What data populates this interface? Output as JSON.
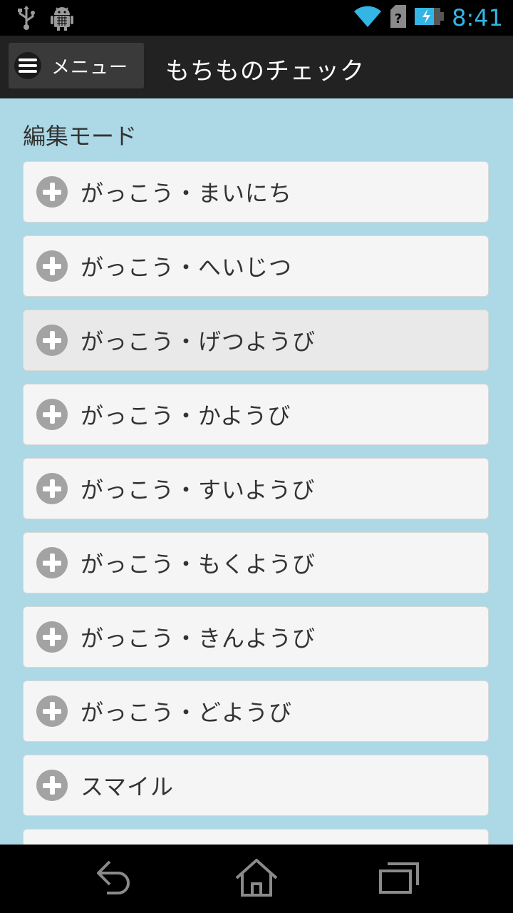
{
  "status_bar": {
    "time": "8:41",
    "icons": [
      "usb-icon",
      "android-debug-icon",
      "wifi-icon",
      "sim-unknown-icon",
      "battery-charging-icon"
    ],
    "accent_color": "#33b5e5"
  },
  "action_bar": {
    "menu_label": "メニュー",
    "title": "もちものチェック"
  },
  "main": {
    "section_title": "編集モード",
    "items": [
      {
        "label": "がっこう・まいにち"
      },
      {
        "label": "がっこう・へいじつ"
      },
      {
        "label": "がっこう・げつようび"
      },
      {
        "label": "がっこう・かようび"
      },
      {
        "label": "がっこう・すいようび"
      },
      {
        "label": "がっこう・もくようび"
      },
      {
        "label": "がっこう・きんようび"
      },
      {
        "label": "がっこう・どようび"
      },
      {
        "label": "スマイル"
      },
      {
        "label": ""
      }
    ],
    "background_color": "#add8e6"
  },
  "nav_bar": {
    "buttons": [
      "back-icon",
      "home-icon",
      "recents-icon"
    ]
  }
}
